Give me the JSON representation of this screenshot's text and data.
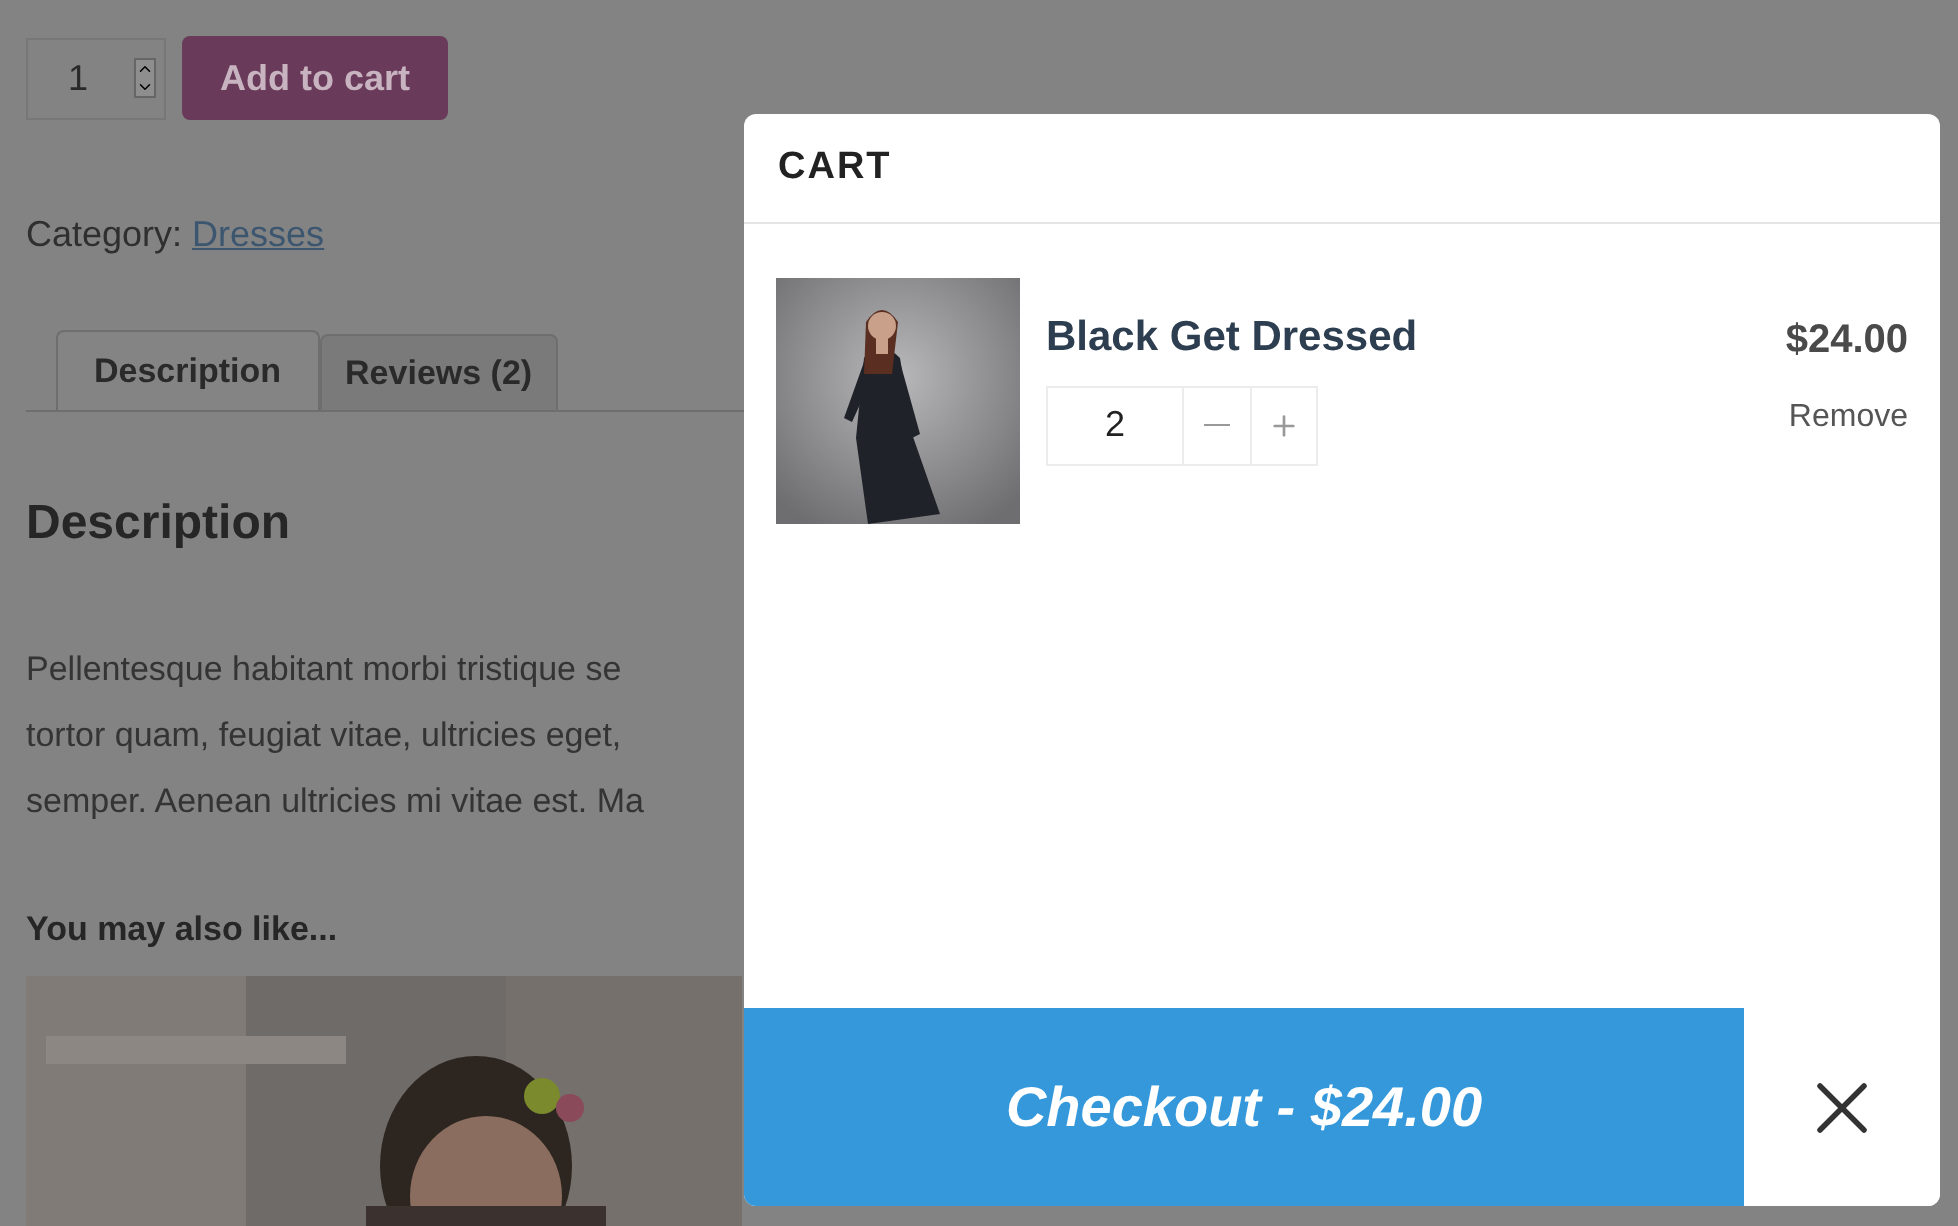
{
  "page": {
    "quantity": "1",
    "add_to_cart": "Add to cart",
    "category_label": "Category:",
    "category_link": "Dresses",
    "tabs": [
      {
        "label": "Description",
        "selected": true
      },
      {
        "label": "Reviews (2)",
        "selected": false
      }
    ],
    "heading": "Description",
    "paragraph_lines": [
      "Pellentesque habitant morbi tristique se",
      "tortor quam, feugiat vitae, ultricies eget,",
      "semper. Aenean ultricies mi vitae est. Ma"
    ],
    "related_heading": "You may also like..."
  },
  "cart": {
    "title": "CART",
    "items": [
      {
        "name": "Black Get Dressed",
        "quantity": "2",
        "price": "$24.00",
        "remove": "Remove"
      }
    ],
    "checkout": "Checkout - $24.00"
  }
}
